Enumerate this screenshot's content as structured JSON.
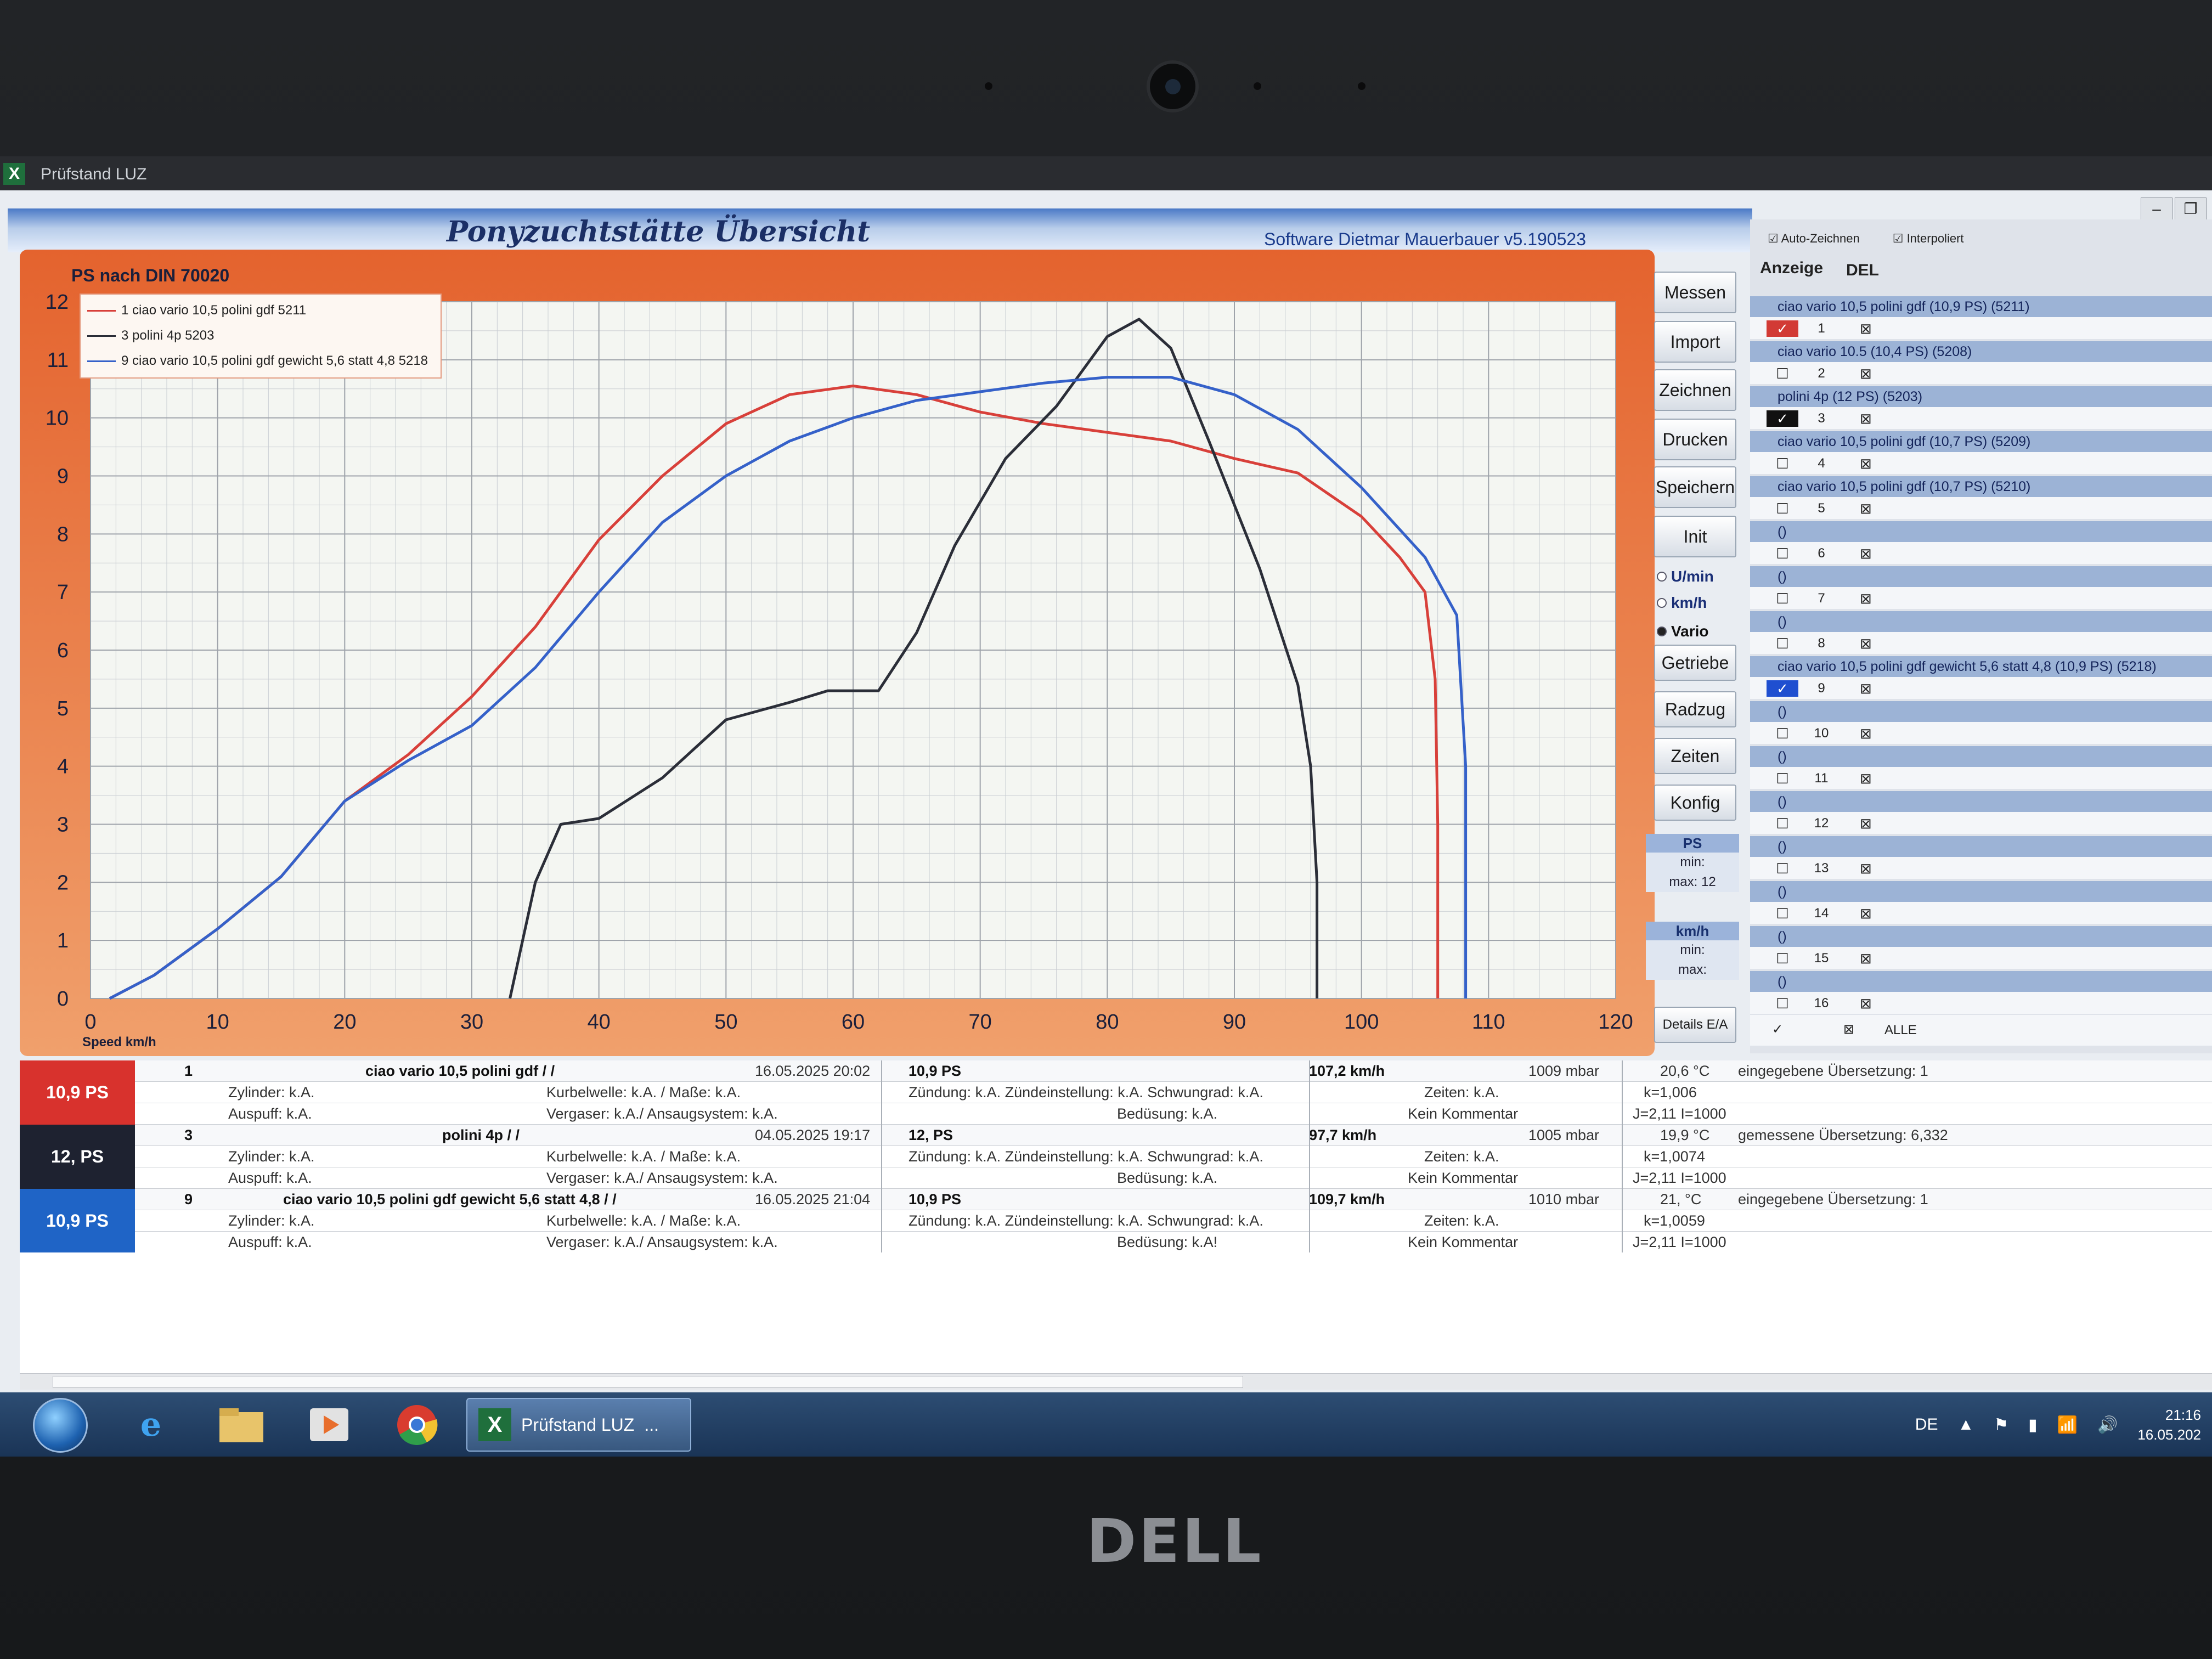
{
  "app": {
    "window_title": "Prüfstand LUZ",
    "header_title": "Ponyzuchtstätte Übersicht",
    "software": "Software Dietmar Mauerbauer v5.190523"
  },
  "chart_data": {
    "type": "line",
    "title": "PS nach DIN 70020",
    "xlabel": "Speed km/h",
    "ylabel": "",
    "xlim": [
      0,
      120
    ],
    "ylim": [
      0,
      12
    ],
    "x_ticks": [
      0,
      10,
      20,
      30,
      40,
      50,
      60,
      70,
      80,
      90,
      100,
      110,
      120
    ],
    "y_ticks": [
      0,
      1,
      2,
      3,
      4,
      5,
      6,
      7,
      8,
      9,
      10,
      11,
      12
    ],
    "grid": true,
    "legend_position": "top-left",
    "series": [
      {
        "name": "1 ciao vario 10,5 polini gdf 5211",
        "color": "#d8403a",
        "points": [
          [
            1.5,
            0
          ],
          [
            5,
            0.4
          ],
          [
            10,
            1.2
          ],
          [
            15,
            2.1
          ],
          [
            20,
            3.4
          ],
          [
            25,
            4.2
          ],
          [
            30,
            5.2
          ],
          [
            35,
            6.4
          ],
          [
            40,
            7.9
          ],
          [
            45,
            9.0
          ],
          [
            50,
            9.9
          ],
          [
            55,
            10.4
          ],
          [
            60,
            10.55
          ],
          [
            65,
            10.4
          ],
          [
            70,
            10.1
          ],
          [
            75,
            9.9
          ],
          [
            80,
            9.75
          ],
          [
            85,
            9.6
          ],
          [
            90,
            9.3
          ],
          [
            95,
            9.05
          ],
          [
            100,
            8.3
          ],
          [
            103,
            7.6
          ],
          [
            105,
            7.0
          ],
          [
            105.8,
            5.5
          ],
          [
            106,
            3.0
          ],
          [
            106,
            0
          ]
        ]
      },
      {
        "name": "3 polini 4p 5203",
        "color": "#2b2e38",
        "points": [
          [
            33,
            0
          ],
          [
            35,
            2.0
          ],
          [
            37,
            3.0
          ],
          [
            40,
            3.1
          ],
          [
            45,
            3.8
          ],
          [
            50,
            4.8
          ],
          [
            55,
            5.1
          ],
          [
            58,
            5.3
          ],
          [
            62,
            5.3
          ],
          [
            65,
            6.3
          ],
          [
            68,
            7.8
          ],
          [
            72,
            9.3
          ],
          [
            76,
            10.2
          ],
          [
            80,
            11.4
          ],
          [
            82.5,
            11.7
          ],
          [
            85,
            11.2
          ],
          [
            88,
            9.6
          ],
          [
            92,
            7.4
          ],
          [
            95,
            5.4
          ],
          [
            96,
            4.0
          ],
          [
            96.5,
            2.0
          ],
          [
            96.5,
            0
          ]
        ]
      },
      {
        "name": "9 ciao vario 10,5 polini gdf gewicht 5,6 statt 4,8 5218",
        "color": "#3561c9",
        "points": [
          [
            1.5,
            0
          ],
          [
            5,
            0.4
          ],
          [
            10,
            1.2
          ],
          [
            15,
            2.1
          ],
          [
            20,
            3.4
          ],
          [
            25,
            4.1
          ],
          [
            30,
            4.7
          ],
          [
            35,
            5.7
          ],
          [
            40,
            7.0
          ],
          [
            45,
            8.2
          ],
          [
            50,
            9.0
          ],
          [
            55,
            9.6
          ],
          [
            60,
            10.0
          ],
          [
            65,
            10.3
          ],
          [
            70,
            10.45
          ],
          [
            75,
            10.6
          ],
          [
            80,
            10.7
          ],
          [
            85,
            10.7
          ],
          [
            90,
            10.4
          ],
          [
            95,
            9.8
          ],
          [
            100,
            8.8
          ],
          [
            105,
            7.6
          ],
          [
            107.5,
            6.6
          ],
          [
            108.2,
            4.0
          ],
          [
            108.2,
            0
          ]
        ]
      }
    ]
  },
  "sidebar": {
    "buttons": [
      "Messen",
      "Import",
      "Zeichnen",
      "Drucken",
      "Speichern",
      "Init"
    ],
    "radios": [
      "U/min",
      "km/h",
      "Vario"
    ],
    "buttons2": [
      "Getriebe",
      "Radzug",
      "Zeiten",
      "Konfig"
    ],
    "ps_header": "PS",
    "ps_min": "min:",
    "ps_max": "max: 12",
    "kmh_header": "km/h",
    "kmh_min": "min:",
    "kmh_max": "max:",
    "details_button": "Details E/A"
  },
  "panel": {
    "auto_zeichnen": "Auto-Zeichnen",
    "interpoliert": "Interpoliert",
    "anzeige": "Anzeige",
    "del": "DEL",
    "alle": "ALLE",
    "footer_check": "✓",
    "footer_x": "⊠",
    "items": [
      {
        "name": "ciao vario 10,5 polini gdf (10,9 PS) (5211)",
        "num": "1",
        "check": "✓",
        "style": "red"
      },
      {
        "name": "ciao vario 10.5 (10,4 PS) (5208)",
        "num": "2",
        "check": "☐",
        "style": ""
      },
      {
        "name": "polini 4p (12 PS) (5203)",
        "num": "3",
        "check": "✓",
        "style": "blk"
      },
      {
        "name": "ciao vario 10,5 polini gdf (10,7 PS) (5209)",
        "num": "4",
        "check": "☐",
        "style": ""
      },
      {
        "name": "ciao vario 10,5 polini gdf (10,7 PS) (5210)",
        "num": "5",
        "check": "☐",
        "style": ""
      },
      {
        "name": "()",
        "num": "6",
        "check": "☐",
        "style": ""
      },
      {
        "name": "()",
        "num": "7",
        "check": "☐",
        "style": ""
      },
      {
        "name": "()",
        "num": "8",
        "check": "☐",
        "style": ""
      },
      {
        "name": "ciao vario 10,5 polini gdf gewicht 5,6 statt 4,8 (10,9 PS) (5218)",
        "num": "9",
        "check": "✓",
        "style": "blu"
      },
      {
        "name": "()",
        "num": "10",
        "check": "☐",
        "style": ""
      },
      {
        "name": "()",
        "num": "11",
        "check": "☐",
        "style": ""
      },
      {
        "name": "()",
        "num": "12",
        "check": "☐",
        "style": ""
      },
      {
        "name": "()",
        "num": "13",
        "check": "☐",
        "style": ""
      },
      {
        "name": "()",
        "num": "14",
        "check": "☐",
        "style": ""
      },
      {
        "name": "()",
        "num": "15",
        "check": "☐",
        "style": ""
      },
      {
        "name": "()",
        "num": "16",
        "check": "☐",
        "style": ""
      }
    ],
    "del_icon": "⊠"
  },
  "details": [
    {
      "badge": "10,9 PS",
      "color": "#d8322d",
      "nr": "1",
      "name": "ciao vario 10,5 polini gdf /  /",
      "date": "16.05.2025 20:02",
      "ps": "10,9  PS",
      "speed": "107,2 km/h",
      "pressure": "1009  mbar",
      "temp": "20,6 °C",
      "ratio": "eingegebene Übersetzung: 1",
      "zylinder": "Zylinder: k.A.",
      "kurbelwelle": "Kurbelwelle: k.A. / Maße: k.A.",
      "zuendung": "Zündung: k.A.  Zündeinstellung: k.A. Schwungrad: k.A.",
      "zeiten": "Zeiten: k.A.",
      "k": "k=1,006",
      "auspuff": "Auspuff: k.A.",
      "vergaser": "Vergaser: k.A./ Ansaugsystem: k.A.",
      "beduesung": "Bedüsung: k.A.",
      "kommentar": "Kein Kommentar",
      "j": "J=2,11 I=1000"
    },
    {
      "badge": "12, PS",
      "color": "#1e2230",
      "nr": "3",
      "name": "polini 4p /  /",
      "date": "04.05.2025 19:17",
      "ps": "12,  PS",
      "speed": "97,7 km/h",
      "pressure": "1005  mbar",
      "temp": "19,9 °C",
      "ratio": "gemessene Übersetzung: 6,332",
      "zylinder": "Zylinder: k.A.",
      "kurbelwelle": "Kurbelwelle: k.A. / Maße: k.A.",
      "zuendung": "Zündung: k.A.  Zündeinstellung: k.A. Schwungrad: k.A.",
      "zeiten": "Zeiten: k.A.",
      "k": "k=1,0074",
      "auspuff": "Auspuff: k.A.",
      "vergaser": "Vergaser: k.A./ Ansaugsystem: k.A.",
      "beduesung": "Bedüsung: k.A.",
      "kommentar": "Kein Kommentar",
      "j": "J=2,11 I=1000"
    },
    {
      "badge": "10,9  PS",
      "color": "#1f64c6",
      "nr": "9",
      "name": "ciao vario 10,5 polini gdf gewicht 5,6 statt 4,8 /  /",
      "date": "16.05.2025 21:04",
      "ps": "10,9  PS",
      "speed": "109,7 km/h",
      "pressure": "1010  mbar",
      "temp": "21, °C",
      "ratio": "eingegebene Übersetzung: 1",
      "zylinder": "Zylinder: k.A.",
      "kurbelwelle": "Kurbelwelle: k.A. / Maße: k.A.",
      "zuendung": "Zündung: k.A.  Zündeinstellung: k.A. Schwungrad: k.A.",
      "zeiten": "Zeiten: k.A.",
      "k": "k=1,0059",
      "auspuff": "Auspuff: k.A.",
      "vergaser": "Vergaser: k.A./ Ansaugsystem: k.A.",
      "beduesung": "Bedüsung: k.A!",
      "kommentar": "Kein Kommentar",
      "j": "J=2,11 I=1000"
    }
  ],
  "taskbar": {
    "active_task": "Prüfstand LUZ",
    "more": "...",
    "lang": "DE",
    "time": "21:16",
    "date": "16.05.202"
  },
  "brand": "DELL"
}
